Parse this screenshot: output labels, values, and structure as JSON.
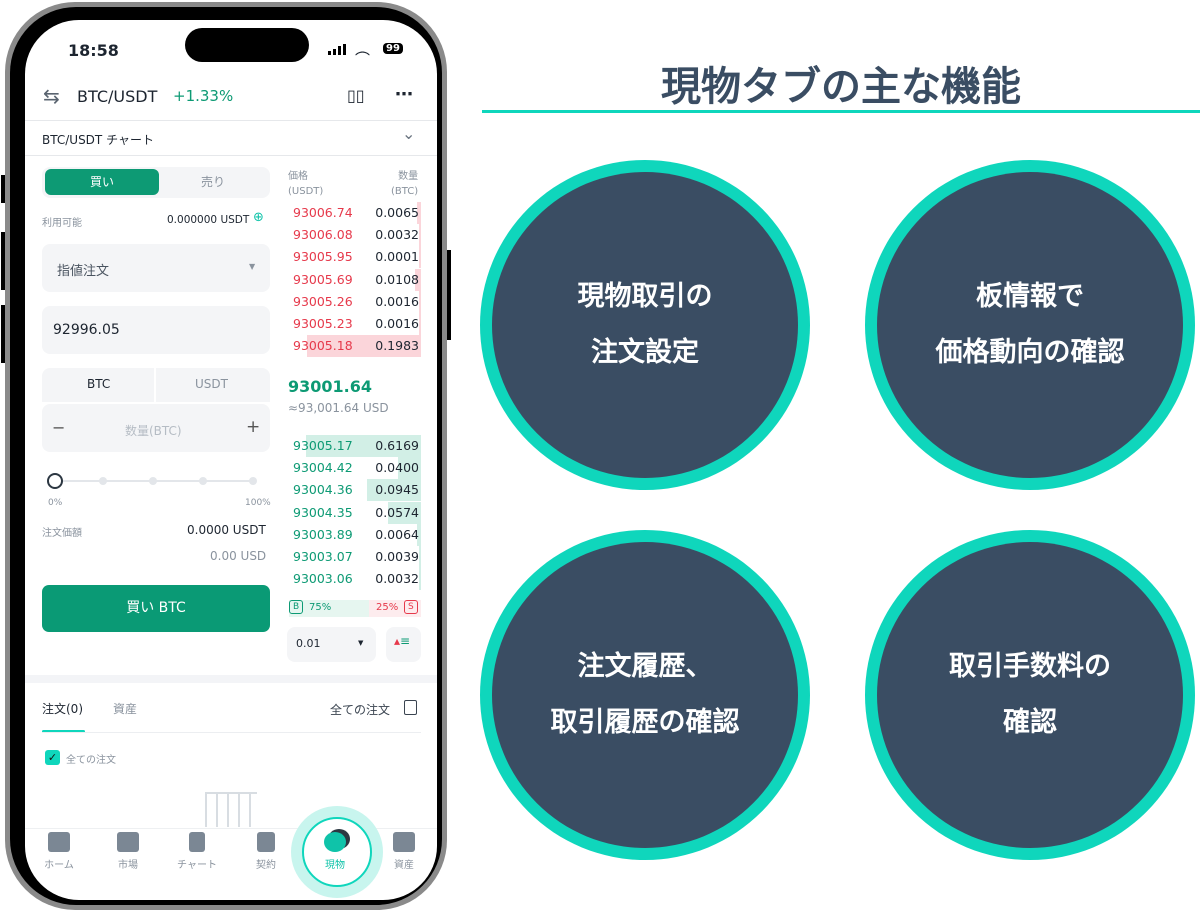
{
  "status_bar": {
    "time": "18:58",
    "battery": "99"
  },
  "header": {
    "pair": "BTC/USDT",
    "change": "+1.33%",
    "chart_toggle": "BTC/USDT チャート"
  },
  "order_form": {
    "tabs": [
      "買い",
      "売り"
    ],
    "available_label": "利用可能",
    "available_value": "0.000000 USDT",
    "order_type": "指値注文",
    "price": "92996.05",
    "unit_tabs": [
      "BTC",
      "USDT"
    ],
    "amount_placeholder": "数量(BTC)",
    "slider_min": "0%",
    "slider_max": "100%",
    "slider_value": 0,
    "total_label": "注文価額",
    "total_value": "0.0000 USDT",
    "total_usd": "0.00 USD",
    "submit": "買い BTC"
  },
  "orderbook": {
    "price_header": "価格",
    "price_unit": "(USDT)",
    "qty_header": "数量",
    "qty_unit": "(BTC)",
    "asks": [
      [
        "93006.74",
        "0.0065"
      ],
      [
        "93006.08",
        "0.0032"
      ],
      [
        "93005.95",
        "0.0001"
      ],
      [
        "93005.69",
        "0.0108"
      ],
      [
        "93005.26",
        "0.0016"
      ],
      [
        "93005.23",
        "0.0016"
      ],
      [
        "93005.18",
        "0.1983"
      ]
    ],
    "last_price": "93001.64",
    "last_price_usd": "≈93,001.64 USD",
    "bids": [
      [
        "93005.17",
        "0.6169"
      ],
      [
        "93004.42",
        "0.0400"
      ],
      [
        "93004.36",
        "0.0945"
      ],
      [
        "93004.35",
        "0.0574"
      ],
      [
        "93003.89",
        "0.0064"
      ],
      [
        "93003.07",
        "0.0039"
      ],
      [
        "93003.06",
        "0.0032"
      ]
    ],
    "buy_badge": "B",
    "buy_ratio": "75%",
    "sell_ratio": "25%",
    "sell_badge": "S",
    "precision": "0.01"
  },
  "orders": {
    "tabs": [
      "注文(0)",
      "資産"
    ],
    "all_orders": "全ての注文",
    "checkbox_label": "全ての注文"
  },
  "bottom_nav": [
    "ホーム",
    "市場",
    "チャート",
    "契約",
    "現物",
    "資産"
  ],
  "panel": {
    "title": "現物タブの主な機能",
    "features": [
      [
        "現物取引の",
        "注文設定"
      ],
      [
        "板情報で",
        "価格動向の確認"
      ],
      [
        "注文履歴、",
        "取引履歴の確認"
      ],
      [
        "取引手数料の",
        "確認"
      ]
    ]
  },
  "colors": {
    "accent": "#0fd6bc",
    "buy": "#0d9a74",
    "sell": "#e6394b",
    "circle": "#3a4d63"
  }
}
